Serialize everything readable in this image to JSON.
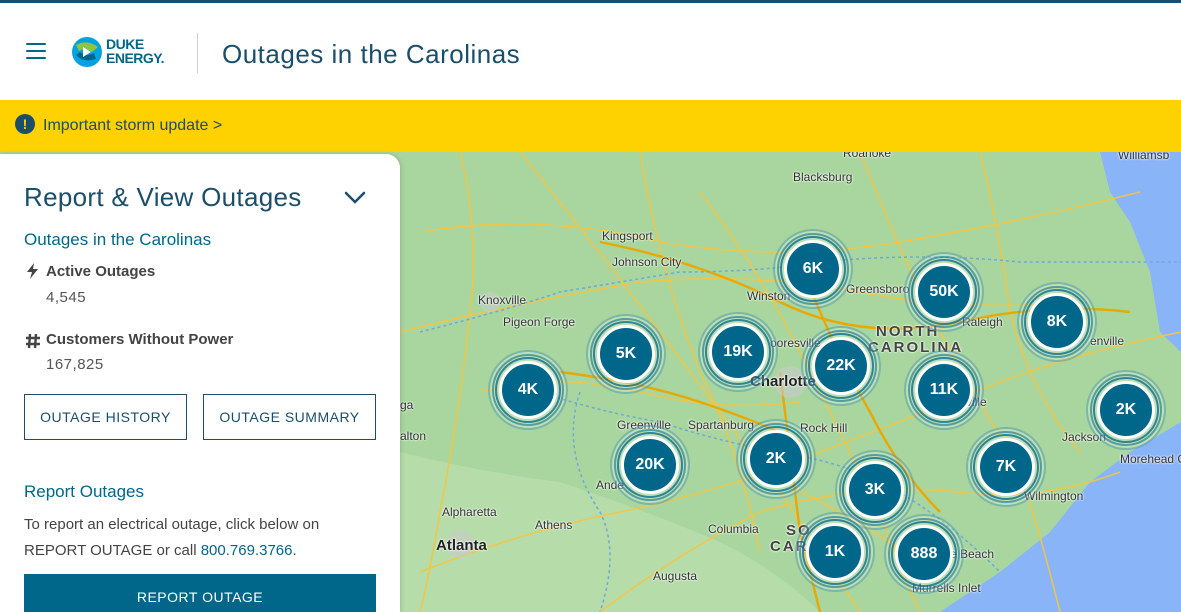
{
  "header": {
    "logo_line1": "DUKE",
    "logo_line2": "ENERGY.",
    "title": "Outages in the Carolinas"
  },
  "alert": {
    "icon": "!",
    "text": "Important storm update >"
  },
  "panel": {
    "title": "Report & View Outages",
    "subtitle": "Outages in the Carolinas",
    "active_label": "Active Outages",
    "active_value": "4,545",
    "customers_label": "Customers Without Power",
    "customers_value": "167,825",
    "history_button": "OUTAGE HISTORY",
    "summary_button": "OUTAGE SUMMARY",
    "report_title": "Report Outages",
    "report_desc": "To report an electrical outage, click below on REPORT OUTAGE or call ",
    "phone": "800.769.3766",
    "period": ".",
    "report_button": "REPORT OUTAGE"
  },
  "map": {
    "labels": {
      "roanoke": "Roanoke",
      "blacksburg": "Blacksburg",
      "kingsport": "Kingsport",
      "johnson_city": "Johnson City",
      "knoxville": "Knoxville",
      "pigeon_forge": "Pigeon Forge",
      "winston": "Winston",
      "greensboro": "Greensboro",
      "raleigh": "Raleigh",
      "north_carolina_1": "NORTH",
      "north_carolina_2": "CAROLINA",
      "charlotte": "Charlotte",
      "mooresville": "ooresville",
      "greenville_sc": "Greenville",
      "spartanburg": "Spartanburg",
      "rock_hill": "Rock Hill",
      "greenville_nc": "enville",
      "jacksonville": "Jackson",
      "morehead": "Morehead C",
      "wilmington": "Wilmington",
      "alpharetta": "Alpharetta",
      "athens": "Athens",
      "atlanta": "Atlanta",
      "columbia": "Columbia",
      "augusta": "Augusta",
      "south_carolina_1": "SO",
      "south_carolina_2": "CAR",
      "myrtle": "e Beach",
      "murrells": "Murrells Inlet",
      "williamsburg": "Williamsb",
      "ga": "ga",
      "alton": "alton",
      "ville": "ville",
      "ande": "Ande"
    },
    "clusters": [
      {
        "label": "6K"
      },
      {
        "label": "50K"
      },
      {
        "label": "8K"
      },
      {
        "label": "5K"
      },
      {
        "label": "19K"
      },
      {
        "label": "22K"
      },
      {
        "label": "11K"
      },
      {
        "label": "4K"
      },
      {
        "label": "2K"
      },
      {
        "label": "20K"
      },
      {
        "label": "2K"
      },
      {
        "label": "3K"
      },
      {
        "label": "7K"
      },
      {
        "label": "1K"
      },
      {
        "label": "888"
      }
    ]
  }
}
